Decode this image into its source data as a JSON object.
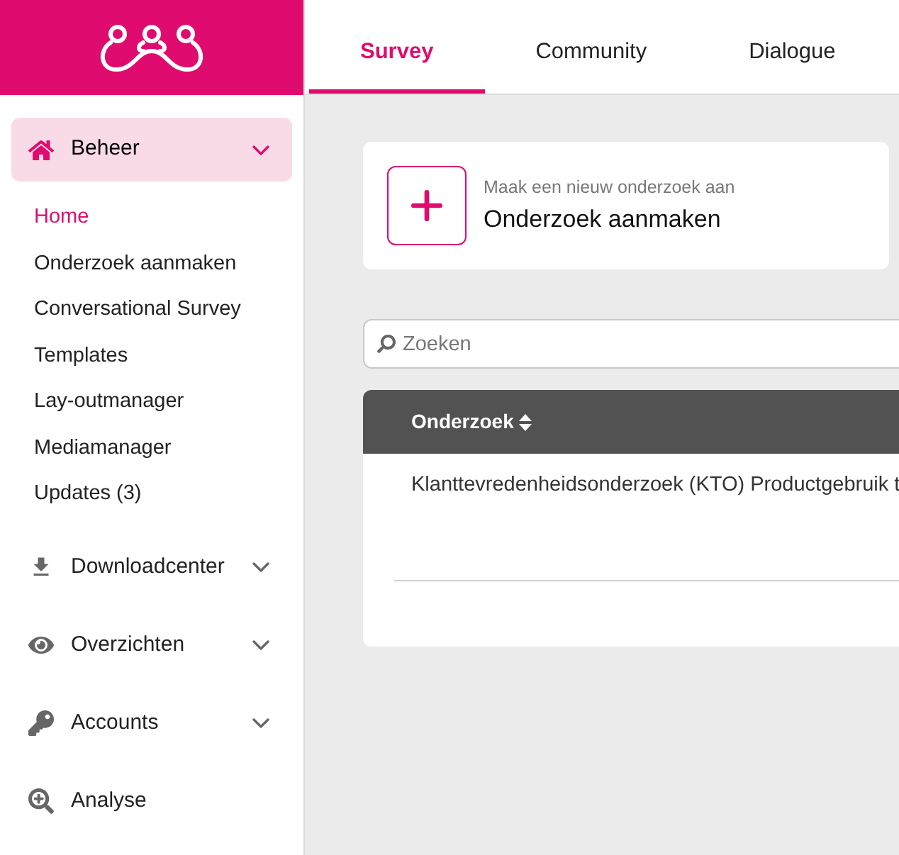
{
  "tabs": [
    {
      "label": "Survey",
      "selected": true
    },
    {
      "label": "Community",
      "selected": false
    },
    {
      "label": "Dialogue",
      "selected": false
    }
  ],
  "sidebar": {
    "groups": [
      {
        "kind": "group",
        "label": "Beheer",
        "expanded": true,
        "children": [
          {
            "label": "Home",
            "selected": true
          },
          {
            "label": "Onderzoek aanmaken",
            "selected": false
          },
          {
            "label": "Conversational Survey",
            "selected": false
          },
          {
            "label": "Templates",
            "selected": false
          },
          {
            "label": "Lay-outmanager",
            "selected": false
          },
          {
            "label": "Mediamanager",
            "selected": false
          },
          {
            "label": "Updates (3)",
            "selected": false
          }
        ]
      },
      {
        "kind": "group",
        "label": "Downloadcenter",
        "expanded": false
      },
      {
        "kind": "group",
        "label": "Overzichten",
        "expanded": false
      },
      {
        "kind": "group",
        "label": "Accounts",
        "expanded": false
      },
      {
        "kind": "link",
        "label": "Analyse"
      }
    ]
  },
  "create_card": {
    "hint": "Maak een nieuw onderzoek aan",
    "title": "Onderzoek aanmaken"
  },
  "search": {
    "placeholder": "Zoeken"
  },
  "table": {
    "columns": [
      "Onderzoek"
    ],
    "rows": [
      "Klanttevredenheidsonderzoek (KTO) Productgebruik t"
    ]
  }
}
